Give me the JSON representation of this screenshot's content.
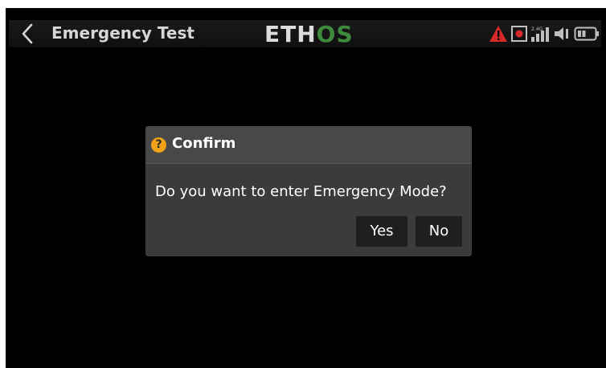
{
  "header": {
    "title": "Emergency Test",
    "logo": {
      "part1": "ETH",
      "part2": "OS",
      "part1_color": "#dcdcdc",
      "part2_color": "#3d8a3d"
    },
    "status_icons": [
      "warning-icon",
      "record-icon",
      "signal-icon",
      "speaker-icon",
      "battery-icon"
    ],
    "signal_label": "2.4G"
  },
  "dialog": {
    "title": "Confirm",
    "message": "Do you want to enter Emergency Mode?",
    "yes_label": "Yes",
    "no_label": "No",
    "icon": "question-icon",
    "icon_color": "#f0a318"
  },
  "colors": {
    "warning": "#d42a2a",
    "accent": "#3d8a3d"
  }
}
